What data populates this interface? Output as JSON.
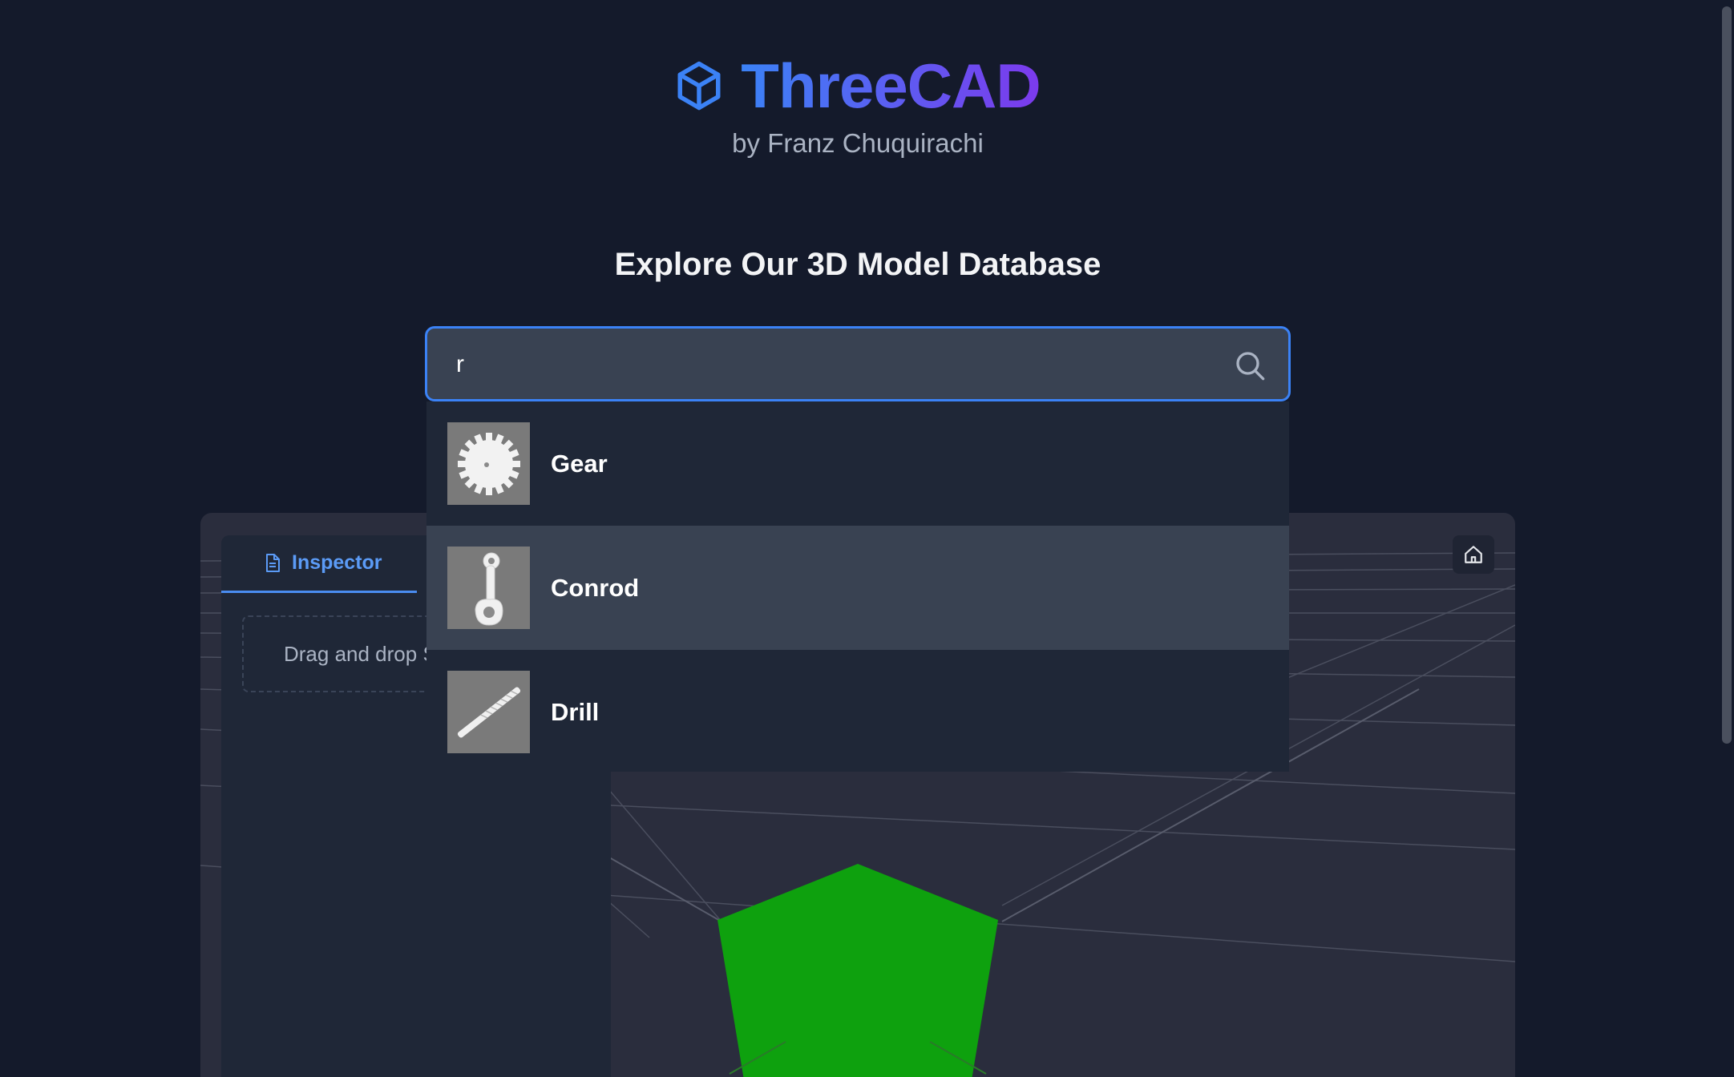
{
  "brand": {
    "title": "ThreeCAD",
    "subtitle": "by Franz Chuquirachi",
    "gradient_start": "#3b82f6",
    "gradient_end": "#7c3aed",
    "logo_icon": "cube-icon"
  },
  "section": {
    "title": "Explore Our 3D Model Database"
  },
  "search": {
    "value": "r",
    "icon": "search-icon",
    "focus_color": "#3b82f6"
  },
  "results": [
    {
      "label": "Gear",
      "thumbnail": "gear-thumbnail",
      "highlighted": false
    },
    {
      "label": "Conrod",
      "thumbnail": "conrod-thumbnail",
      "highlighted": true
    },
    {
      "label": "Drill",
      "thumbnail": "drill-thumbnail",
      "highlighted": false
    }
  ],
  "workspace": {
    "tabs": [
      {
        "label": "Inspector",
        "icon": "document-icon",
        "active": true
      }
    ],
    "dropzone_text": "Drag and drop S",
    "home_icon": "home-icon",
    "model_color": "#0ea10e"
  }
}
